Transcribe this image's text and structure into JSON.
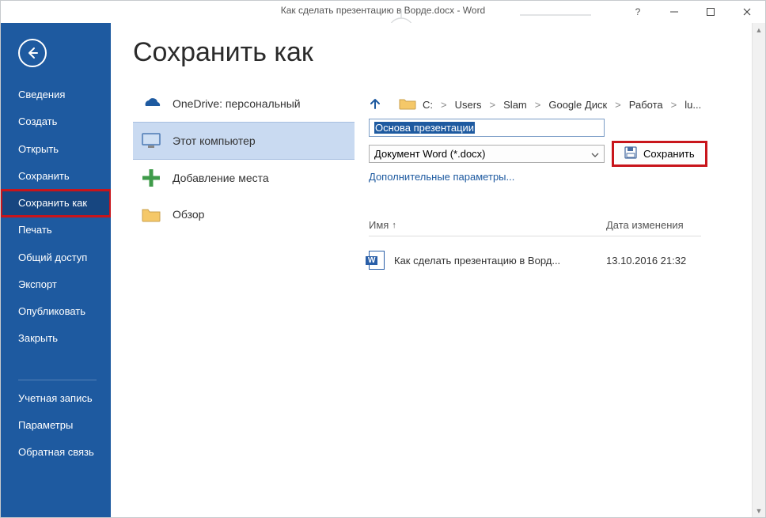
{
  "window": {
    "title": "Как сделать презентацию в Ворде.docx - Word"
  },
  "sidebar": {
    "items": [
      {
        "label": "Сведения"
      },
      {
        "label": "Создать"
      },
      {
        "label": "Открыть"
      },
      {
        "label": "Сохранить"
      },
      {
        "label": "Сохранить как"
      },
      {
        "label": "Печать"
      },
      {
        "label": "Общий доступ"
      },
      {
        "label": "Экспорт"
      },
      {
        "label": "Опубликовать"
      },
      {
        "label": "Закрыть"
      }
    ],
    "footer_items": [
      {
        "label": "Учетная запись"
      },
      {
        "label": "Параметры"
      },
      {
        "label": "Обратная связь"
      }
    ]
  },
  "page": {
    "heading": "Сохранить как",
    "locations": [
      {
        "label": "OneDrive: персональный"
      },
      {
        "label": "Этот компьютер"
      },
      {
        "label": "Добавление места"
      },
      {
        "label": "Обзор"
      }
    ],
    "path": [
      "C:",
      "Users",
      "Slam",
      "Google Диск",
      "Работа",
      "lu..."
    ],
    "filename": "Основа презентации",
    "filetype": "Документ Word (*.docx)",
    "save_label": "Сохранить",
    "more_options": "Дополнительные параметры...",
    "columns": {
      "name": "Имя",
      "modified": "Дата изменения"
    },
    "files": [
      {
        "name": "Как сделать презентацию в Ворд...",
        "modified": "13.10.2016 21:32"
      }
    ]
  },
  "glyphs": {
    "help": "?",
    "arrow_up": "↑"
  }
}
